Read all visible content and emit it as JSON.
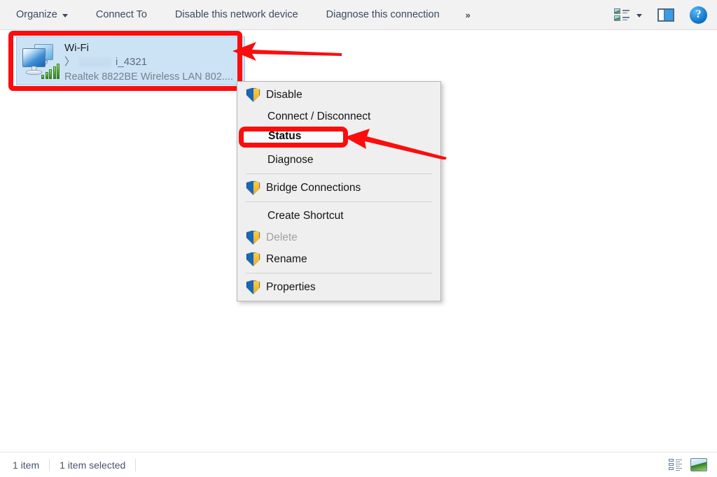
{
  "toolbar": {
    "organize": "Organize",
    "connect_to": "Connect To",
    "disable_device": "Disable this network device",
    "diagnose_connection": "Diagnose this connection",
    "overflow": "»",
    "view_options_icon": "view-options-icon",
    "view_options_caret": "chevron-down-icon",
    "preview_pane_icon": "preview-pane-icon",
    "help_icon": "?"
  },
  "connection": {
    "name": "Wi-Fi",
    "ssid_prefix": "〉",
    "ssid_suffix": "i_4321",
    "adapter": "Realtek 8822BE Wireless LAN 802....",
    "icon": "network-connection-icon",
    "selected": true,
    "highlight_color": "#fc0d0d",
    "selection_color": "#cce3f6"
  },
  "context_menu": {
    "items": [
      {
        "label": "Disable",
        "shield": true,
        "disabled": false,
        "bold": false,
        "separator_after": false
      },
      {
        "label": "Connect / Disconnect",
        "shield": false,
        "disabled": false,
        "bold": false,
        "separator_after": false
      },
      {
        "label": "Status",
        "shield": false,
        "disabled": false,
        "bold": true,
        "separator_after": false,
        "highlighted": true
      },
      {
        "label": "Diagnose",
        "shield": false,
        "disabled": false,
        "bold": false,
        "separator_after": true
      },
      {
        "label": "Bridge Connections",
        "shield": true,
        "disabled": false,
        "bold": false,
        "separator_after": true
      },
      {
        "label": "Create Shortcut",
        "shield": false,
        "disabled": false,
        "bold": false,
        "separator_after": false
      },
      {
        "label": "Delete",
        "shield": true,
        "disabled": true,
        "bold": false,
        "separator_after": false
      },
      {
        "label": "Rename",
        "shield": true,
        "disabled": false,
        "bold": false,
        "separator_after": true
      },
      {
        "label": "Properties",
        "shield": true,
        "disabled": false,
        "bold": false,
        "separator_after": false
      }
    ]
  },
  "annotations": {
    "arrow_color": "#fc0d0d",
    "arrow_1_target": "wifi-connection-item",
    "arrow_2_target": "status-menu-item"
  },
  "statusbar": {
    "item_count": "1 item",
    "selection": "1 item selected",
    "details_view_icon": "details-view-icon",
    "large_icons_view_icon": "large-icons-view-icon"
  }
}
